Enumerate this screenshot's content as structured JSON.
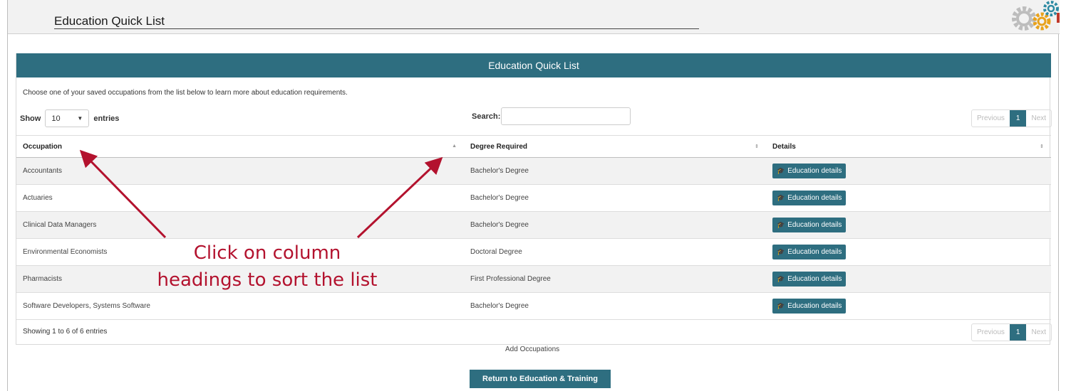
{
  "header": {
    "title": "Education Quick List"
  },
  "panel": {
    "title": "Education Quick List",
    "intro": "Choose one of your saved occupations from the list below to learn more about education requirements.",
    "show_label": "Show",
    "entries_value": "10",
    "entries_label": "entries",
    "search_label": "Search:",
    "search_value": ""
  },
  "pager": {
    "previous": "Previous",
    "page": "1",
    "next": "Next"
  },
  "table": {
    "headers": [
      "Occupation",
      "Degree Required",
      "Details"
    ],
    "rows": [
      {
        "occupation": "Accountants",
        "degree": "Bachelor's Degree",
        "details": "Education details"
      },
      {
        "occupation": "Actuaries",
        "degree": "Bachelor's Degree",
        "details": "Education details"
      },
      {
        "occupation": "Clinical Data Managers",
        "degree": "Bachelor's Degree",
        "details": "Education details"
      },
      {
        "occupation": "Environmental Economists",
        "degree": "Doctoral Degree",
        "details": "Education details"
      },
      {
        "occupation": "Pharmacists",
        "degree": "First Professional Degree",
        "details": "Education details"
      },
      {
        "occupation": "Software Developers, Systems Software",
        "degree": "Bachelor's Degree",
        "details": "Education details"
      }
    ]
  },
  "footer": {
    "showing": "Showing 1 to 6 of 6 entries",
    "add_occupations": "Add Occupations",
    "return_button": "Return to Education & Training"
  },
  "annotation": {
    "line1": "Click on column",
    "line2": "headings to sort the list"
  },
  "colors": {
    "accent": "#2e6e80",
    "annotation": "#b3122e",
    "row_stripe": "#f2f2f2"
  }
}
